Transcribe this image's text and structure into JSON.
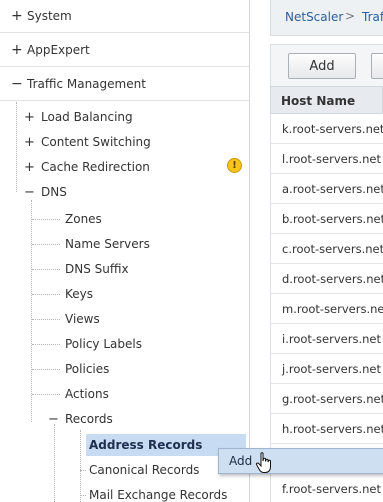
{
  "nav": {
    "top_nodes": [
      {
        "label": "System",
        "expander": "+"
      },
      {
        "label": "AppExpert",
        "expander": "+"
      },
      {
        "label": "Traffic Management",
        "expander": "−"
      }
    ],
    "children": [
      {
        "label": "Load Balancing",
        "expander": "+"
      },
      {
        "label": "Content Switching",
        "expander": "+"
      },
      {
        "label": "Cache Redirection",
        "expander": "+"
      },
      {
        "label": "DNS",
        "expander": "−"
      }
    ],
    "dns_children": [
      {
        "label": "Zones"
      },
      {
        "label": "Name Servers"
      },
      {
        "label": "DNS Suffix"
      },
      {
        "label": "Keys"
      },
      {
        "label": "Views"
      },
      {
        "label": "Policy Labels"
      },
      {
        "label": "Policies"
      },
      {
        "label": "Actions"
      },
      {
        "label": "Records",
        "expander": "−"
      }
    ],
    "records_children": [
      {
        "label": "Address Records",
        "selected": true
      },
      {
        "label": "Canonical Records"
      },
      {
        "label": "Mail Exchange Records"
      }
    ],
    "warning_icon": "warning-icon",
    "warning_glyph": "!"
  },
  "breadcrumb": {
    "items": [
      "NetScaler",
      "Traf"
    ],
    "separator": ">"
  },
  "toolbar": {
    "add_label": "Add"
  },
  "table": {
    "header": "Host Name",
    "rows": [
      "k.root-servers.net",
      "l.root-servers.net",
      "a.root-servers.net",
      "b.root-servers.net",
      "c.root-servers.net",
      "d.root-servers.net",
      "m.root-servers.net",
      "i.root-servers.net",
      "j.root-servers.net",
      "g.root-servers.net",
      "h.root-servers.net",
      "",
      "f.root-servers.net"
    ]
  },
  "context_menu": {
    "items": [
      "Add"
    ]
  },
  "colors": {
    "selection": "#c7dcf3",
    "link": "#2b5f9e",
    "warning": "#f5c518"
  }
}
